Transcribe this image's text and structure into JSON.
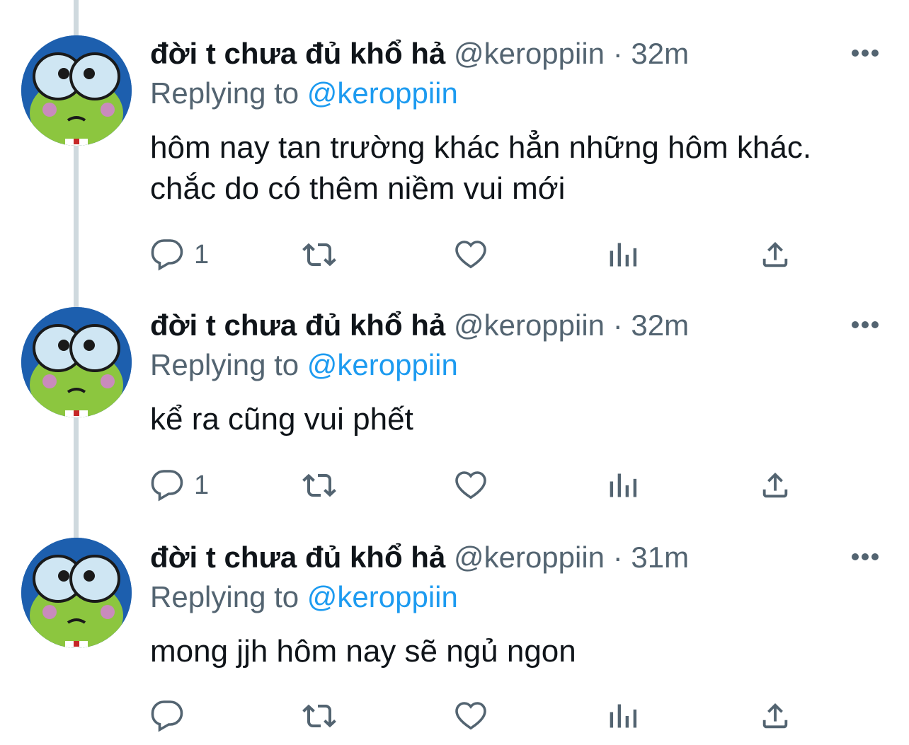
{
  "tweets": [
    {
      "name": "đời t chưa đủ khổ hả",
      "handle": "@keroppiin",
      "separator": "·",
      "time": "32m",
      "replying_label": "Replying to",
      "replying_to": "@keroppiin",
      "text": "hôm nay tan trường khác hẳn những hôm khác. chắc do có thêm niềm vui mới",
      "reply_count": "1",
      "avatar_icon": "keroppi-frog-avatar"
    },
    {
      "name": "đời t chưa đủ khổ hả",
      "handle": "@keroppiin",
      "separator": "·",
      "time": "32m",
      "replying_label": "Replying to",
      "replying_to": "@keroppiin",
      "text": "kể ra cũng vui phết",
      "reply_count": "1",
      "avatar_icon": "keroppi-frog-avatar"
    },
    {
      "name": "đời t chưa đủ khổ hả",
      "handle": "@keroppiin",
      "separator": "·",
      "time": "31m",
      "replying_label": "Replying to",
      "replying_to": "@keroppiin",
      "text": "mong jjh hôm nay sẽ ngủ ngon",
      "reply_count": "",
      "avatar_icon": "keroppi-frog-avatar"
    }
  ],
  "icons": [
    "more-icon",
    "reply-icon",
    "retweet-icon",
    "like-icon",
    "analytics-icon",
    "share-icon"
  ],
  "colors": {
    "link": "#1d9bf0",
    "secondary": "#536471",
    "primary_text": "#0f1419",
    "thread_line": "#cfd9de"
  }
}
